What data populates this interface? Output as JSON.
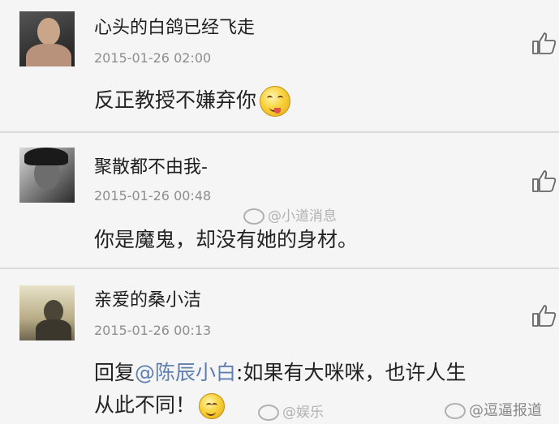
{
  "comments": [
    {
      "username": "心头的白鸽已经飞走",
      "time": "2015-01-26 02:00",
      "text": "反正教授不嫌弃你",
      "emoji": "smirk-tongue-emoji"
    },
    {
      "username": "聚散都不由我-",
      "time": "2015-01-26 00:48",
      "text": "你是魔鬼，却没有她的身材。"
    },
    {
      "username": "亲爱的桑小洁",
      "time": "2015-01-26 00:13",
      "reply_prefix": "回复",
      "mention": "@陈辰小白",
      "reply_text": ":如果有大咪咪，也许人生",
      "text_line2": "从此不同！",
      "emoji": "blush-emoji"
    }
  ],
  "watermarks": {
    "center": "@小道消息",
    "bottom_left": "@娱乐",
    "bottom_right": "@逗逼报道"
  },
  "icons": {
    "like": "thumbs-up-icon",
    "weibo": "weibo-icon"
  }
}
